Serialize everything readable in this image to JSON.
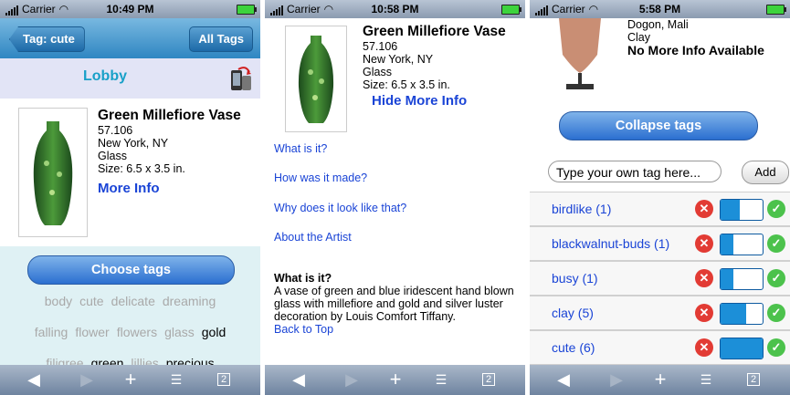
{
  "status": {
    "carrier": "Carrier",
    "times": [
      "10:49 PM",
      "10:58 PM",
      "5:58 PM"
    ]
  },
  "screen1": {
    "back_label": "Tag: cute",
    "all_tags_label": "All Tags",
    "location_title": "Lobby",
    "object": {
      "name": "Green Millefiore Vase",
      "number": "57.106",
      "place": "New York, NY",
      "material": "Glass",
      "size": "Size: 6.5 x 3.5 in.",
      "more_label": "More Info"
    },
    "choose_tags_label": "Choose tags",
    "tag_rows": [
      [
        {
          "text": "body",
          "selected": false
        },
        {
          "text": "cute",
          "selected": false
        },
        {
          "text": "delicate",
          "selected": false
        },
        {
          "text": "dreaming",
          "selected": false
        }
      ],
      [
        {
          "text": "falling",
          "selected": false
        },
        {
          "text": "flower",
          "selected": false
        },
        {
          "text": "flowers",
          "selected": false
        },
        {
          "text": "glass",
          "selected": false
        },
        {
          "text": "gold",
          "selected": true
        }
      ],
      [
        {
          "text": "filigree",
          "selected": false
        },
        {
          "text": "green",
          "selected": true
        },
        {
          "text": "lillies",
          "selected": false
        },
        {
          "text": "precious",
          "selected": true
        }
      ]
    ]
  },
  "screen2": {
    "object": {
      "name": "Green Millefiore Vase",
      "number": "57.106",
      "place": "New York, NY",
      "material": "Glass",
      "size": "Size: 6.5 x 3.5 in.",
      "hide_label": "Hide More Info"
    },
    "links": [
      "What is it?",
      "How was it made?",
      "Why does it look like that?",
      "About the Artist"
    ],
    "section_heading": "What is it?",
    "section_text": "A vase of green and blue iridescent hand blown glass with millefiore and gold and silver luster decoration by Louis Comfort Tiffany.",
    "back_to_top": "Back to Top"
  },
  "screen3": {
    "object_lines": [
      "Dogon, Mali",
      "Clay"
    ],
    "no_more_info": "No More Info Available",
    "collapse_label": "Collapse tags",
    "tag_input_value": "Type your own tag here...",
    "add_label": "Add",
    "tags": [
      {
        "label": "birdlike (1)",
        "level": 0.45
      },
      {
        "label": "blackwalnut-buds (1)",
        "level": 0.3
      },
      {
        "label": "busy (1)",
        "level": 0.3
      },
      {
        "label": "clay (5)",
        "level": 0.6
      },
      {
        "label": "cute (6)",
        "level": 1.0
      }
    ]
  },
  "toolbar": {
    "back": "◀",
    "forward": "▶",
    "add": "+",
    "bookmarks": "📖",
    "pages": "2"
  }
}
